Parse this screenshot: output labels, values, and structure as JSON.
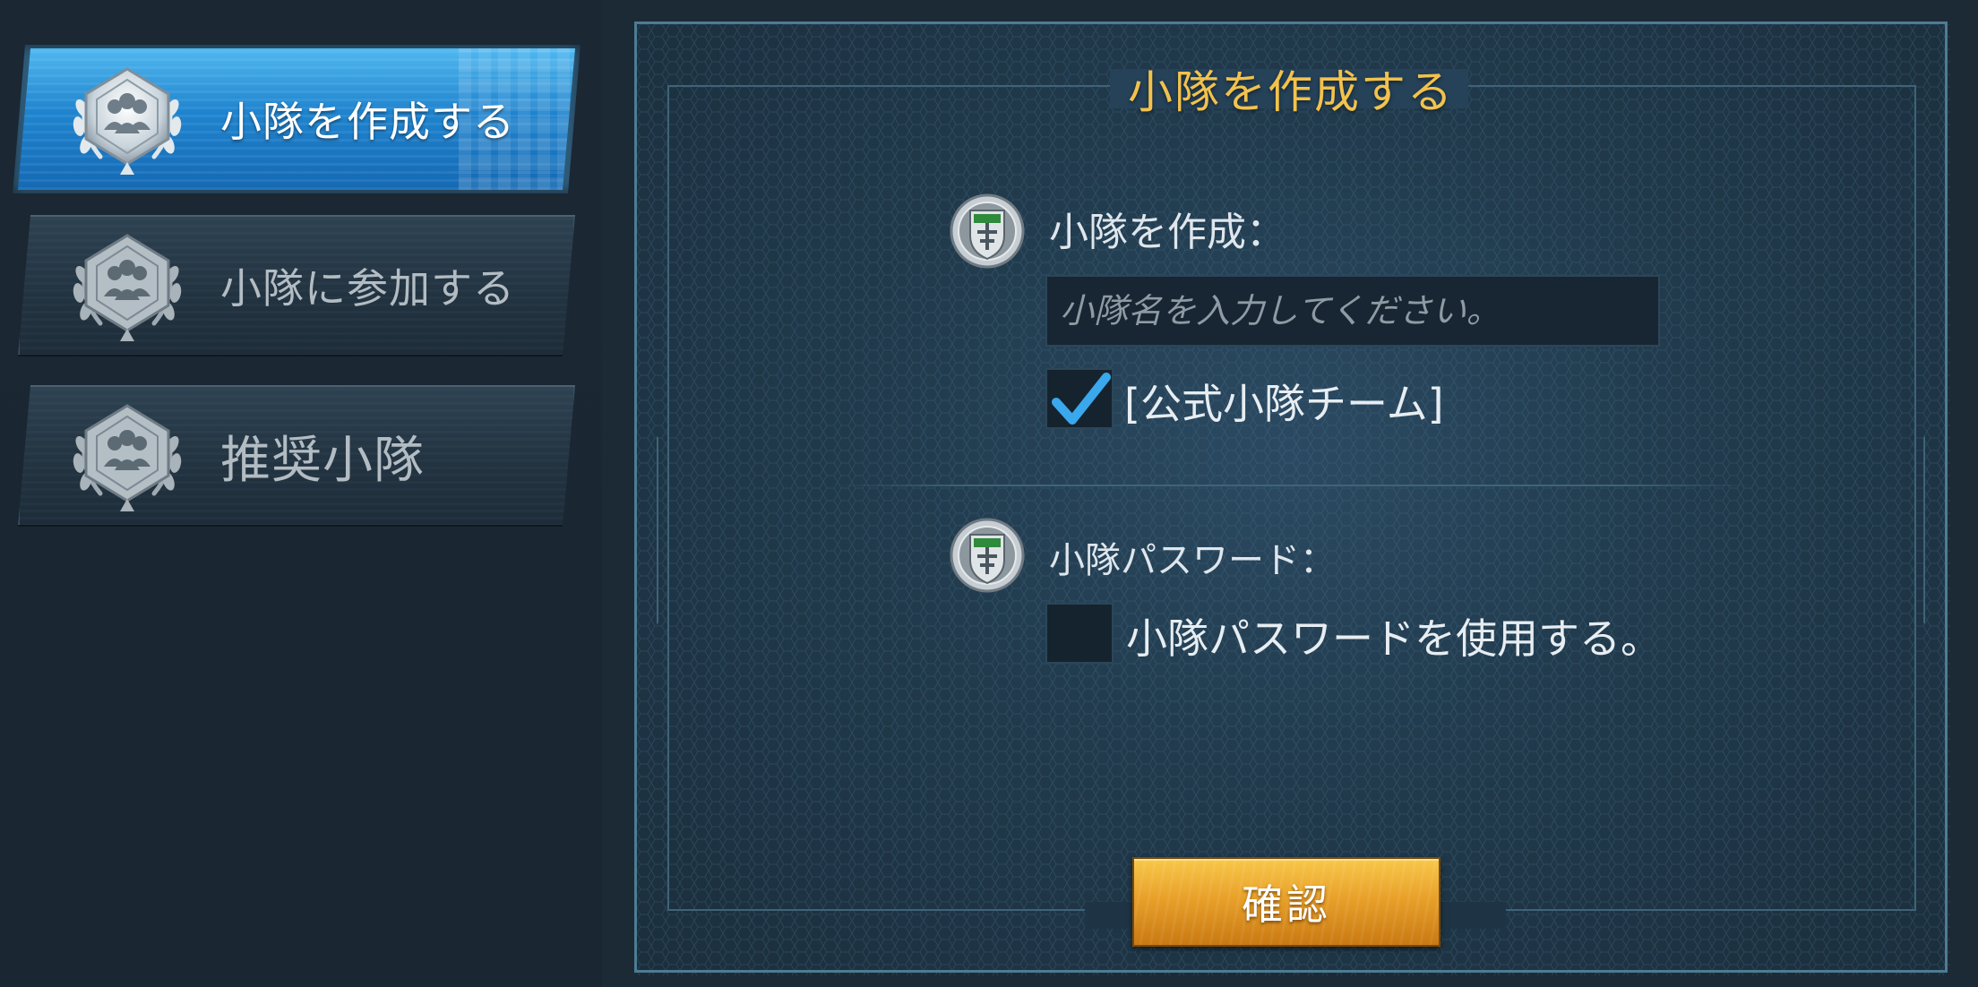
{
  "sidebar": {
    "items": [
      {
        "label": "小隊を作成する",
        "icon": "squad-laurel-icon",
        "active": true
      },
      {
        "label": "小隊に参加する",
        "icon": "squad-laurel-icon",
        "active": false
      },
      {
        "label": "推奨小隊",
        "icon": "squad-laurel-icon",
        "active": false
      }
    ]
  },
  "panel": {
    "title": "小隊を作成する",
    "create": {
      "label": "小隊を作成：",
      "icon": "rank-emblem-icon",
      "name_placeholder": "小隊名を入力してください。",
      "name_value": "",
      "official_checkbox_label": "[公式小隊チーム]",
      "official_checked": true
    },
    "password": {
      "label": "小隊パスワード：",
      "icon": "rank-emblem-icon",
      "use_password_label": "小隊パスワードを使用する。",
      "use_password_checked": false
    },
    "confirm_label": "確認"
  },
  "colors": {
    "title_gold": "#f2c24d",
    "active_blue": "#1f84cf",
    "confirm_orange": "#e9a12a",
    "check_blue": "#3aa8ec"
  }
}
